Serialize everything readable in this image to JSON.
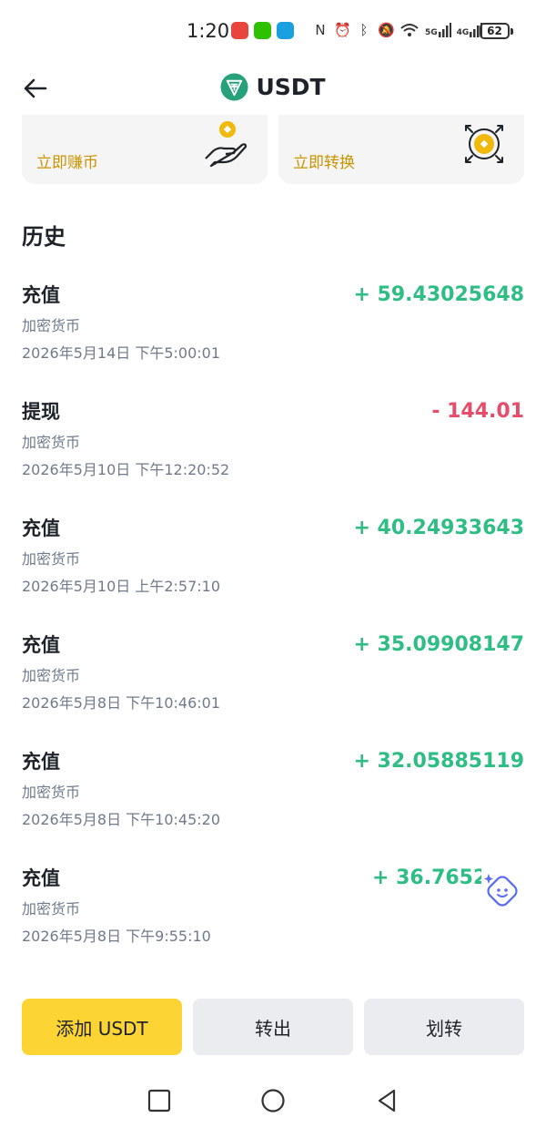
{
  "status_bar": {
    "time": "1:20",
    "signal_5g": "5G",
    "signal_4g": "4G",
    "battery": "62"
  },
  "header": {
    "title": "USDT"
  },
  "cards": [
    {
      "label": "立即赚币",
      "icon": "coin-hand-icon"
    },
    {
      "label": "立即转换",
      "icon": "coin-convert-icon"
    }
  ],
  "history": {
    "title": "历史",
    "items": [
      {
        "type": "充值",
        "subtitle": "加密货币",
        "date": "2026年5月14日 下午5:00:01",
        "amount": "+ 59.43025648",
        "direction": "in"
      },
      {
        "type": "提现",
        "subtitle": "加密货币",
        "date": "2026年5月10日 下午12:20:52",
        "amount": "- 144.01",
        "direction": "out"
      },
      {
        "type": "充值",
        "subtitle": "加密货币",
        "date": "2026年5月10日 上午2:57:10",
        "amount": "+ 40.24933643",
        "direction": "in"
      },
      {
        "type": "充值",
        "subtitle": "加密货币",
        "date": "2026年5月8日 下午10:46:01",
        "amount": "+ 35.09908147",
        "direction": "in"
      },
      {
        "type": "充值",
        "subtitle": "加密货币",
        "date": "2026年5月8日 下午10:45:20",
        "amount": "+ 32.05885119",
        "direction": "in"
      },
      {
        "type": "充值",
        "subtitle": "加密货币",
        "date": "2026年5月8日 下午9:55:10",
        "amount": "+ 36.76527",
        "direction": "in"
      }
    ]
  },
  "actions": {
    "add": "添加 USDT",
    "withdraw": "转出",
    "transfer": "划转"
  },
  "colors": {
    "positive": "#2ebd85",
    "negative": "#e54d6a",
    "brand": "#fcd535",
    "accent_text": "#c99400",
    "usdt": "#26a17b"
  }
}
